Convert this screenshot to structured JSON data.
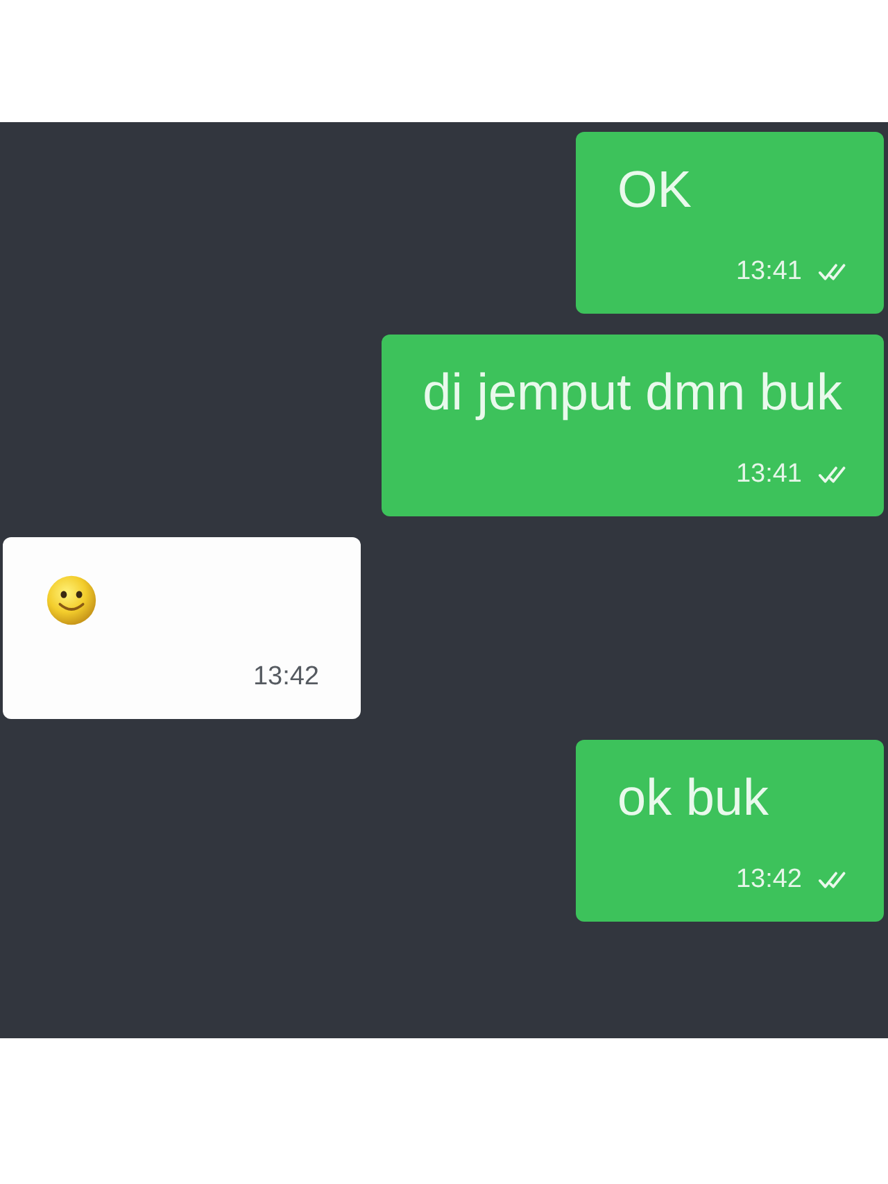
{
  "messages": [
    {
      "outgoing": true,
      "kind": "text",
      "text": "OK",
      "time": "13:41",
      "read": true
    },
    {
      "outgoing": true,
      "kind": "text",
      "text": "di jemput dmn buk",
      "time": "13:41",
      "read": true
    },
    {
      "outgoing": false,
      "kind": "emoji",
      "time": "13:42"
    },
    {
      "outgoing": true,
      "kind": "text",
      "text": "ok buk",
      "time": "13:42",
      "read": true
    }
  ]
}
